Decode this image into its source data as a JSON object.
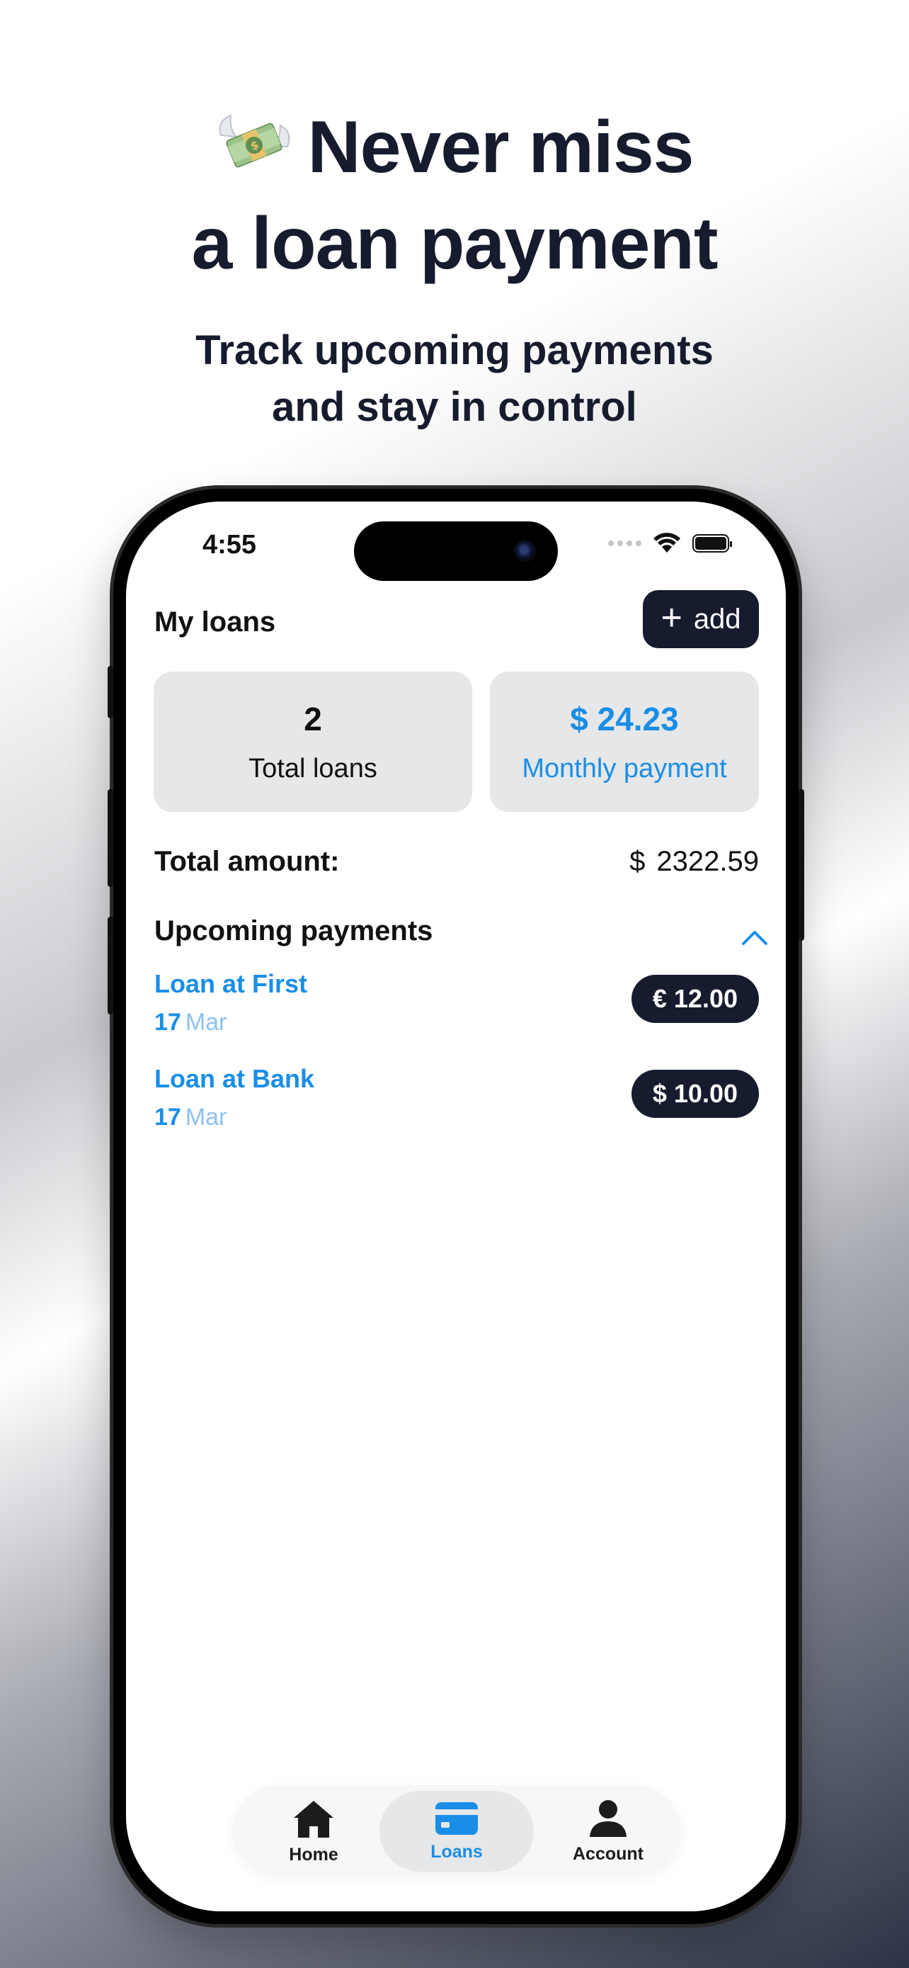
{
  "promo": {
    "headline_line1": "Never miss",
    "headline_line2": "a loan payment",
    "subhead_line1": "Track upcoming payments",
    "subhead_line2": "and stay in control",
    "emoji": "money-with-wings"
  },
  "status_bar": {
    "time": "4:55"
  },
  "header": {
    "title": "My loans",
    "add_label": "add"
  },
  "summary": {
    "total_loans_value": "2",
    "total_loans_label": "Total loans",
    "monthly_value": "$ 24.23",
    "monthly_label": "Monthly payment"
  },
  "total": {
    "label": "Total amount:",
    "currency": "$",
    "value": "2322.59"
  },
  "upcoming": {
    "title": "Upcoming payments",
    "expanded": true,
    "items": [
      {
        "name": "Loan at First",
        "day": "17",
        "month": "Mar",
        "amount": "€ 12.00"
      },
      {
        "name": "Loan at Bank",
        "day": "17",
        "month": "Mar",
        "amount": "$ 10.00"
      }
    ]
  },
  "tabs": [
    {
      "label": "Home",
      "icon": "home-icon",
      "active": false
    },
    {
      "label": "Loans",
      "icon": "card-icon",
      "active": true
    },
    {
      "label": "Account",
      "icon": "person-icon",
      "active": false
    }
  ],
  "colors": {
    "accent": "#1a8ee6",
    "dark": "#161c2e",
    "card_bg": "#e6e7e9"
  }
}
